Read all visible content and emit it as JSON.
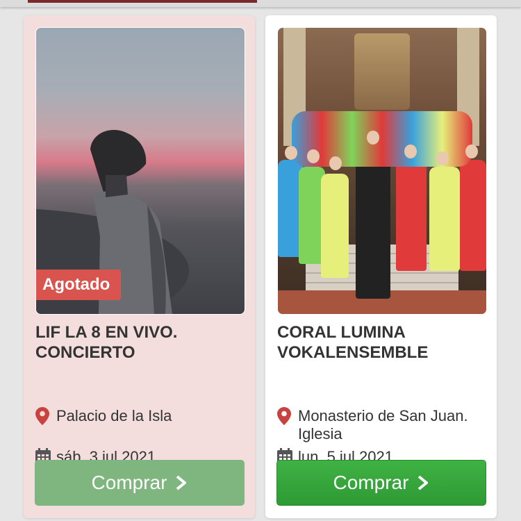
{
  "events": [
    {
      "status_badge": "Agotado",
      "title": "LIF LA 8 EN VIVO. CONCIERTO",
      "venue": "Palacio de la Isla",
      "date": "sáb, 3 jul 2021",
      "button_label": "Comprar",
      "image_icon": "concert-photo",
      "accent": "#d9534f"
    },
    {
      "title": "CORAL LUMINA VOKALENSEMBLE",
      "venue": "Monasterio de San Juan. Iglesia",
      "date": "lun, 5 jul 2021",
      "button_label": "Comprar",
      "image_icon": "choir-photo",
      "accent": "#33a23a"
    }
  ],
  "icons": {
    "location": "map-pin-icon",
    "date": "calendar-icon",
    "chevron": "chevron-right-icon"
  }
}
